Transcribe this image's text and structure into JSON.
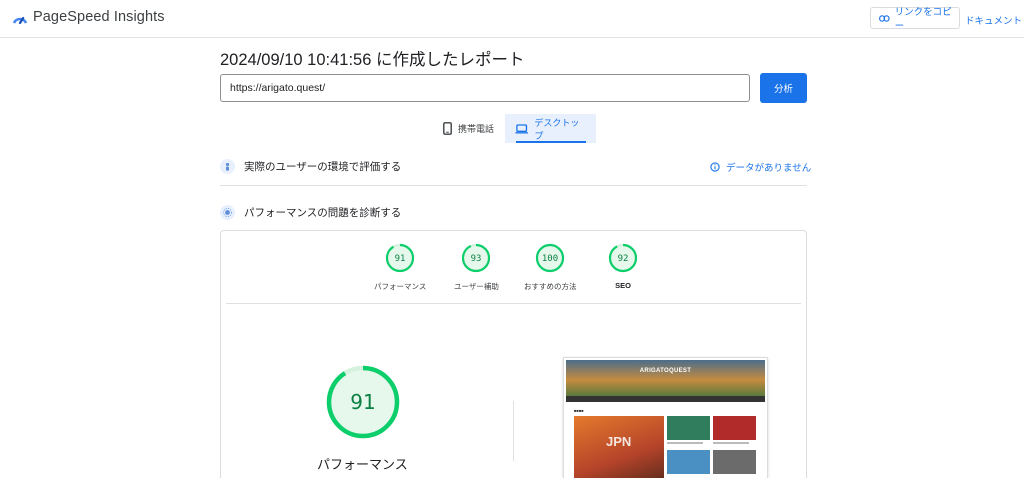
{
  "header": {
    "brand": "PageSpeed Insights",
    "copy_link_label": "リンクをコピー",
    "docs_label": "ドキュメント"
  },
  "report": {
    "title": "2024/09/10 10:41:56 に作成したレポート",
    "url_value": "https://arigato.quest/",
    "analyze_label": "分析"
  },
  "tabs": [
    {
      "label": "携帯電話",
      "icon": "smartphone-icon",
      "selected": false
    },
    {
      "label": "デスクトップ",
      "icon": "laptop-icon",
      "selected": true
    }
  ],
  "field_data": {
    "label": "実際のユーザーの環境で評価する",
    "status": "データがありません"
  },
  "diagnose": {
    "label": "パフォーマンスの問題を診断する"
  },
  "scores": [
    {
      "label": "パフォーマンス",
      "value": "91"
    },
    {
      "label": "ユーザー補助",
      "value": "93"
    },
    {
      "label": "おすすめの方法",
      "value": "100"
    },
    {
      "label": "SEO",
      "value": "92"
    }
  ],
  "performance": {
    "score": "91",
    "label": "パフォーマンス"
  },
  "screenshot": {
    "site_title": "ARIGATOQUEST",
    "hero_text": "JPN"
  },
  "colors": {
    "accent": "#1a73e8",
    "pass": "#0cce6b",
    "pass_text": "#0b8043"
  }
}
